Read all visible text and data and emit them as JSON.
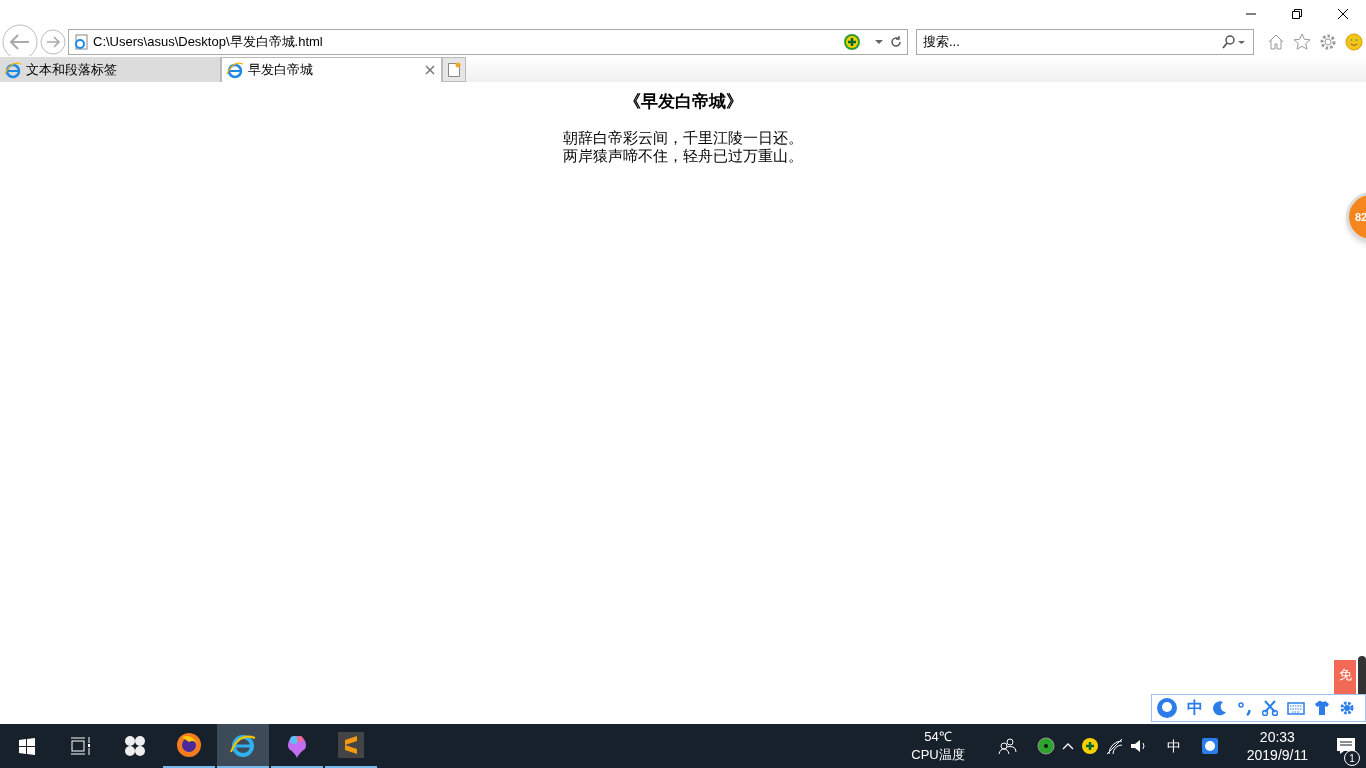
{
  "address_bar": {
    "value": "C:\\Users\\asus\\Desktop\\早发白帝城.html"
  },
  "search": {
    "placeholder": "搜索..."
  },
  "tabs": [
    {
      "label": "文本和段落标签",
      "selected": false
    },
    {
      "label": "早发白帝城",
      "selected": true
    }
  ],
  "page": {
    "heading": "《早发白帝城》",
    "lines": [
      "朝辞白帝彩云间，千里江陵一日还。",
      "两岸猿声啼不住，轻舟已过万重山。"
    ]
  },
  "floating_ball": {
    "value": "82"
  },
  "side_widget": {
    "text": "免"
  },
  "ime_toolbar": {
    "mode": "中"
  },
  "taskbar": {
    "apps": [
      {
        "kind": "windows",
        "active": false
      },
      {
        "kind": "taskview",
        "active": false
      },
      {
        "kind": "fan",
        "active": false
      },
      {
        "kind": "firefox",
        "active": false
      },
      {
        "kind": "ie",
        "active": true
      },
      {
        "kind": "paint",
        "active": false
      },
      {
        "kind": "sublime",
        "active": false
      }
    ],
    "temperature": "54℃",
    "temperature_label": "CPU温度",
    "ime": "中",
    "time": "20:33",
    "date": "2019/9/11",
    "notifications": "1"
  }
}
